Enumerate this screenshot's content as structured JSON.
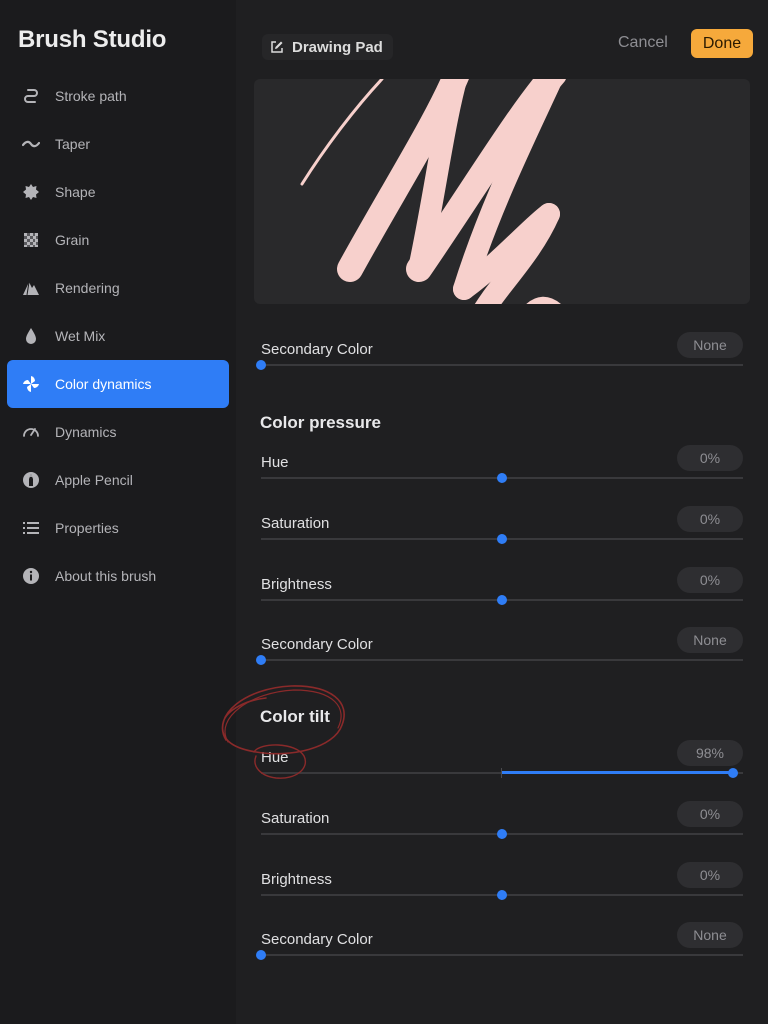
{
  "app": {
    "title": "Brush Studio"
  },
  "sidebar": {
    "items": [
      {
        "label": "Stroke path",
        "icon": "stroke-path-icon",
        "active": false
      },
      {
        "label": "Taper",
        "icon": "taper-icon",
        "active": false
      },
      {
        "label": "Shape",
        "icon": "shape-icon",
        "active": false
      },
      {
        "label": "Grain",
        "icon": "grain-icon",
        "active": false
      },
      {
        "label": "Rendering",
        "icon": "rendering-icon",
        "active": false
      },
      {
        "label": "Wet Mix",
        "icon": "wet-mix-icon",
        "active": false
      },
      {
        "label": "Color dynamics",
        "icon": "color-dynamics-icon",
        "active": true
      },
      {
        "label": "Dynamics",
        "icon": "dynamics-icon",
        "active": false
      },
      {
        "label": "Apple Pencil",
        "icon": "apple-pencil-icon",
        "active": false
      },
      {
        "label": "Properties",
        "icon": "properties-icon",
        "active": false
      },
      {
        "label": "About this brush",
        "icon": "info-icon",
        "active": false
      }
    ]
  },
  "header": {
    "drawing_pad_label": "Drawing Pad",
    "cancel_label": "Cancel",
    "done_label": "Done"
  },
  "colors": {
    "accent": "#2f7df6",
    "done": "#f6a93b",
    "stroke": "#f7d0cc",
    "annotation": "#8a2a2a"
  },
  "top": {
    "secondary": {
      "label": "Secondary Color",
      "value": "None",
      "level": 0
    }
  },
  "color_pressure": {
    "title": "Color pressure",
    "hue": {
      "label": "Hue",
      "value": "0%",
      "level": 0.5
    },
    "saturation": {
      "label": "Saturation",
      "value": "0%",
      "level": 0.5
    },
    "brightness": {
      "label": "Brightness",
      "value": "0%",
      "level": 0.5
    },
    "secondary": {
      "label": "Secondary Color",
      "value": "None",
      "level": 0
    }
  },
  "color_tilt": {
    "title": "Color tilt",
    "hue": {
      "label": "Hue",
      "value": "98%",
      "level": 0.98
    },
    "saturation": {
      "label": "Saturation",
      "value": "0%",
      "level": 0.5
    },
    "brightness": {
      "label": "Brightness",
      "value": "0%",
      "level": 0.5
    },
    "secondary": {
      "label": "Secondary Color",
      "value": "None",
      "level": 0
    }
  }
}
